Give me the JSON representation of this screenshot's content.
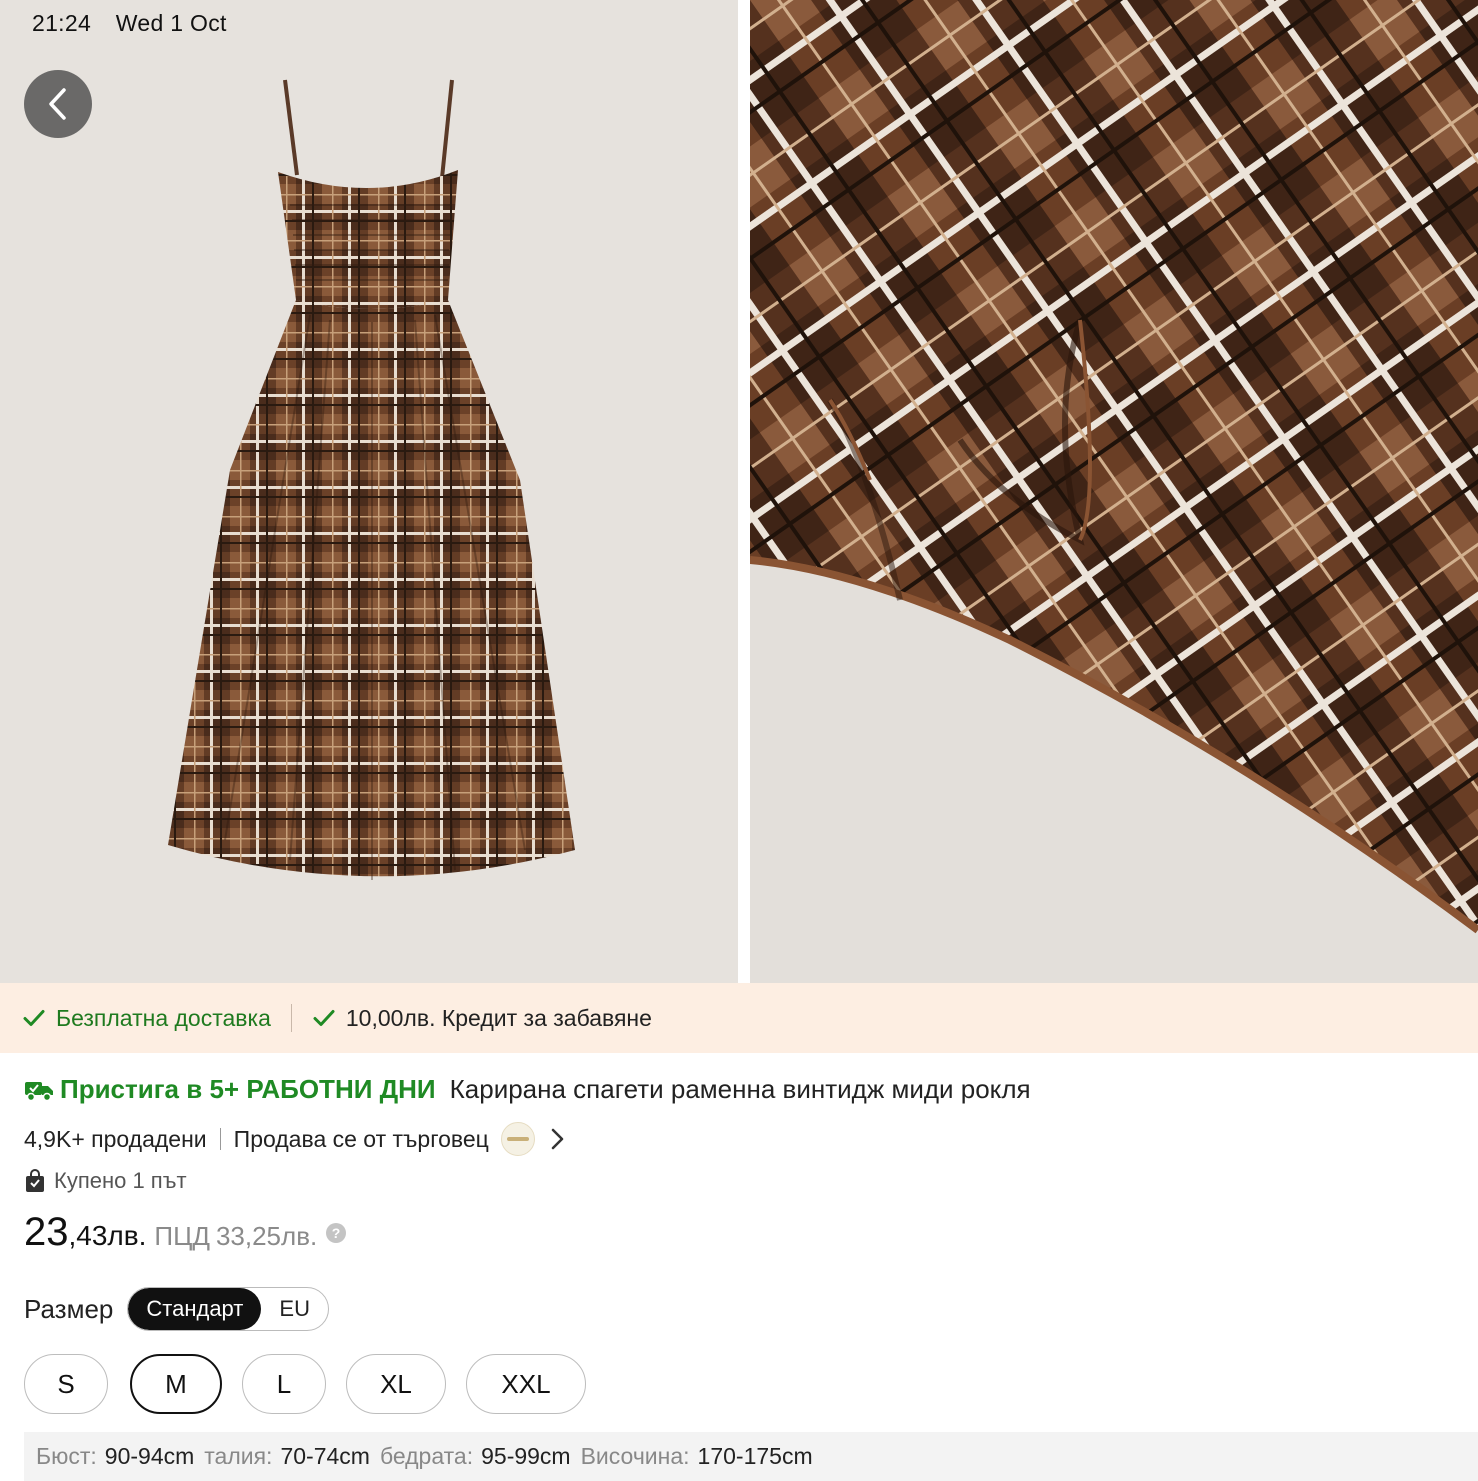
{
  "status_bar": {
    "time": "21:24",
    "date": "Wed 1 Oct"
  },
  "gallery": {
    "back_icon": "chevron-left-icon",
    "images": [
      "plaid-dress-front",
      "plaid-fabric-hem-closeup"
    ]
  },
  "promo": {
    "free_shipping": "Безплатна доставка",
    "delay_credit": "10,00лв. Кредит за забавяне"
  },
  "product": {
    "arrival": "Пристига в 5+ РАБОТНИ ДНИ",
    "title": "Карирана спагети раменна винтидж миди рокля",
    "sold": "4,9K+ продадени",
    "seller": "Продава се от търговец",
    "bought": "Купено 1 път",
    "price_int": "23",
    "price_dec": ",43лв.",
    "rrp_label": "ПЦД",
    "rrp": "33,25лв."
  },
  "size_section": {
    "label": "Размер",
    "standards": [
      "Стандарт",
      "EU"
    ],
    "active_standard": "Стандарт",
    "sizes": [
      "S",
      "M",
      "L",
      "XL",
      "XXL"
    ],
    "selected": "M"
  },
  "measurements": [
    {
      "key": "Бюст:",
      "value": "90-94cm"
    },
    {
      "key": "талия:",
      "value": "70-74cm"
    },
    {
      "key": "бедрата:",
      "value": "95-99cm"
    },
    {
      "key": "Височина:",
      "value": "170-175cm"
    }
  ],
  "colors": {
    "accent_green": "#1f8a24",
    "promo_bg": "#fdeee2"
  }
}
